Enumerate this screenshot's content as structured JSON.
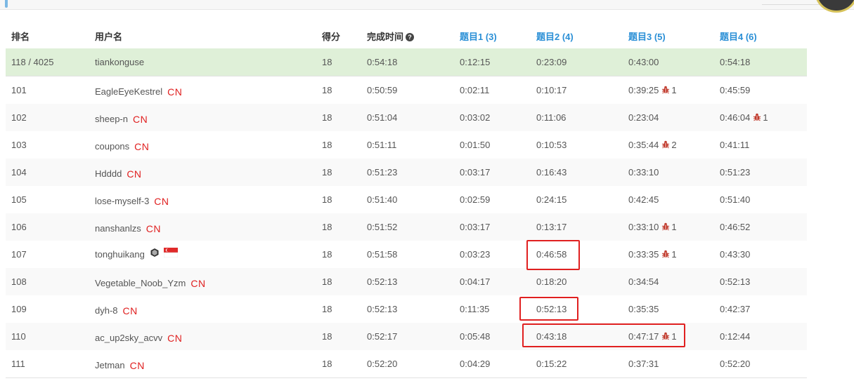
{
  "header": {
    "rank": "排名",
    "username": "用户名",
    "score": "得分",
    "finish_time": "完成时间",
    "q1": "题目1 (3)",
    "q2": "题目2 (4)",
    "q3": "题目3 (5)",
    "q4": "题目4 (6)"
  },
  "colors": {
    "accent_link": "#2a8fd6",
    "self_row_bg": "#dff0d8",
    "country_badge": "#e02020",
    "highlight_box": "#e02020"
  },
  "rows": [
    {
      "rank": "118 / 4025",
      "user": "tiankonguse",
      "score": "18",
      "time": "0:54:18",
      "q1": "0:12:15",
      "q2": "0:23:09",
      "q3": "0:43:00",
      "q4": "0:54:18"
    },
    {
      "rank": "101",
      "user": "EagleEyeKestrel",
      "country": "CN",
      "score": "18",
      "time": "0:50:59",
      "q1": "0:02:11",
      "q2": "0:10:17",
      "q3": "0:39:25",
      "q3_wrong": "1",
      "q4": "0:45:59"
    },
    {
      "rank": "102",
      "user": "sheep-n",
      "country": "CN",
      "score": "18",
      "time": "0:51:04",
      "q1": "0:03:02",
      "q2": "0:11:06",
      "q3": "0:23:04",
      "q4": "0:46:04",
      "q4_wrong": "1"
    },
    {
      "rank": "103",
      "user": "coupons",
      "country": "CN",
      "score": "18",
      "time": "0:51:11",
      "q1": "0:01:50",
      "q2": "0:10:53",
      "q3": "0:35:44",
      "q3_wrong": "2",
      "q4": "0:41:11"
    },
    {
      "rank": "104",
      "user": "Hdddd",
      "country": "CN",
      "score": "18",
      "time": "0:51:23",
      "q1": "0:03:17",
      "q2": "0:16:43",
      "q3": "0:33:10",
      "q4": "0:51:23"
    },
    {
      "rank": "105",
      "user": "lose-myself-3",
      "country": "CN",
      "score": "18",
      "time": "0:51:40",
      "q1": "0:02:59",
      "q2": "0:24:15",
      "q3": "0:42:45",
      "q4": "0:51:40"
    },
    {
      "rank": "106",
      "user": "nanshanlzs",
      "country": "CN",
      "score": "18",
      "time": "0:51:52",
      "q1": "0:03:17",
      "q2": "0:13:17",
      "q3": "0:33:10",
      "q3_wrong": "1",
      "q4": "0:46:52"
    },
    {
      "rank": "107",
      "user": "tonghuikang",
      "icons": [
        "hexagon-badge-icon",
        "singapore-flag-icon"
      ],
      "score": "18",
      "time": "0:51:58",
      "q1": "0:03:23",
      "q2": "0:46:58",
      "q3": "0:33:35",
      "q3_wrong": "1",
      "q4": "0:43:30"
    },
    {
      "rank": "108",
      "user": "Vegetable_Noob_Yzm",
      "country": "CN",
      "score": "18",
      "time": "0:52:13",
      "q1": "0:04:17",
      "q2": "0:18:20",
      "q3": "0:34:54",
      "q4": "0:52:13"
    },
    {
      "rank": "109",
      "user": "dyh-8",
      "country": "CN",
      "score": "18",
      "time": "0:52:13",
      "q1": "0:11:35",
      "q2": "0:52:13",
      "q3": "0:35:35",
      "q4": "0:42:37"
    },
    {
      "rank": "110",
      "user": "ac_up2sky_acvv",
      "country": "CN",
      "score": "18",
      "time": "0:52:17",
      "q1": "0:05:48",
      "q2": "0:43:18",
      "q3": "0:47:17",
      "q3_wrong": "1",
      "q4": "0:12:44"
    },
    {
      "rank": "111",
      "user": "Jetman",
      "country": "CN",
      "score": "18",
      "time": "0:52:20",
      "q1": "0:04:29",
      "q2": "0:15:22",
      "q3": "0:37:31",
      "q4": "0:52:20"
    }
  ]
}
